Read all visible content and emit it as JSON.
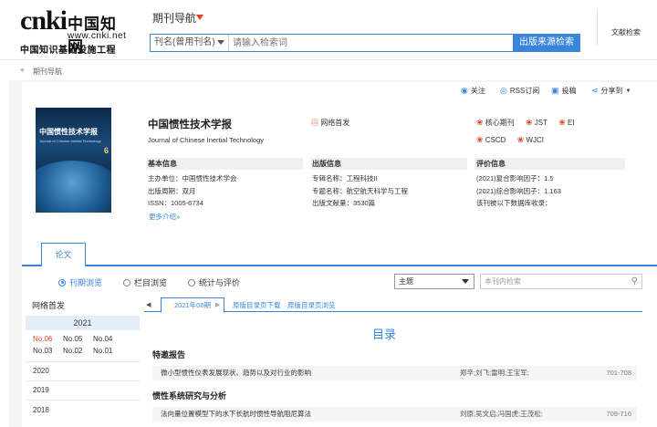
{
  "header": {
    "logo_mark": "cnki",
    "logo_cn": "中国知网",
    "logo_url": "www.cnki.net",
    "logo_sub": "中国知识基础设施工程",
    "nav_title": "期刊导航",
    "search_field": "刊名(曾用刊名)",
    "search_placeholder": "请输入检索词",
    "search_button": "出版来源检索",
    "lit_search": "文献检索"
  },
  "breadcrumb": "期刊导航",
  "actions": [
    {
      "icon": "eye-icon",
      "label": "关注"
    },
    {
      "icon": "rss-icon",
      "label": "RSS订阅"
    },
    {
      "icon": "submit-icon",
      "label": "投稿"
    },
    {
      "icon": "share-icon",
      "label": "分享到"
    }
  ],
  "journal": {
    "title": "中国惯性技术学报",
    "title_en": "Journal of Chinese Inertial Technology",
    "first_publish": "网络首发",
    "cover_title": "中国惯性技术学报",
    "cover_en": "Journal of Chinese Inertial Technology",
    "cover_issue": "6",
    "badges": [
      "核心期刊",
      "JST",
      "EI",
      "CSCD",
      "WJCI"
    ]
  },
  "basic": {
    "heading": "基本信息",
    "host": "主办单位：中国惯性技术学会",
    "period": "出版周期：双月",
    "issn": "ISSN：1005-6734",
    "more": "更多介绍»"
  },
  "pubinfo": {
    "heading": "出版信息",
    "series": "专辑名称：工程科技II",
    "topic": "专题名称：航空航天科学与工程",
    "count": "出版文献量：3530篇"
  },
  "evaluation": {
    "heading": "评价信息",
    "composite": "(2021)复合影响因子：1.5",
    "comprehensive": "(2021)综合影响因子：1.163",
    "indexed": "该刊被以下数据库收录："
  },
  "tabs": {
    "papers": "论文"
  },
  "browse": {
    "by_issue": "刊期浏览",
    "by_column": "栏目浏览",
    "stats": "统计与评价",
    "theme": "主题",
    "search_placeholder": "本刊内检索"
  },
  "leftnav": {
    "heading": "网络首发",
    "year": "2021",
    "issues": [
      "No.06",
      "No.05",
      "No.04",
      "No.03",
      "No.02",
      "No.01"
    ],
    "years": [
      "2020",
      "2019",
      "2018"
    ]
  },
  "toc_tabs": {
    "current": "2021年06期",
    "download": "原版目录页下载",
    "browse": "原版目录页浏览"
  },
  "toc": {
    "title": "目录",
    "sections": [
      {
        "name": "特邀报告",
        "articles": [
          {
            "title": "微小型惯性仪表发展现状、趋势以及对行业的影响",
            "authors": "郑辛;刘飞;雷明;王宝军;",
            "pages": "701-708"
          }
        ]
      },
      {
        "name": "惯性系统研究与分析",
        "articles": [
          {
            "title": "法向量位置模型下的水下长航时惯性导航阻尼算法",
            "authors": "刘原;吴文启;冯国虎;王茂松;",
            "pages": "709-716"
          }
        ]
      }
    ]
  }
}
